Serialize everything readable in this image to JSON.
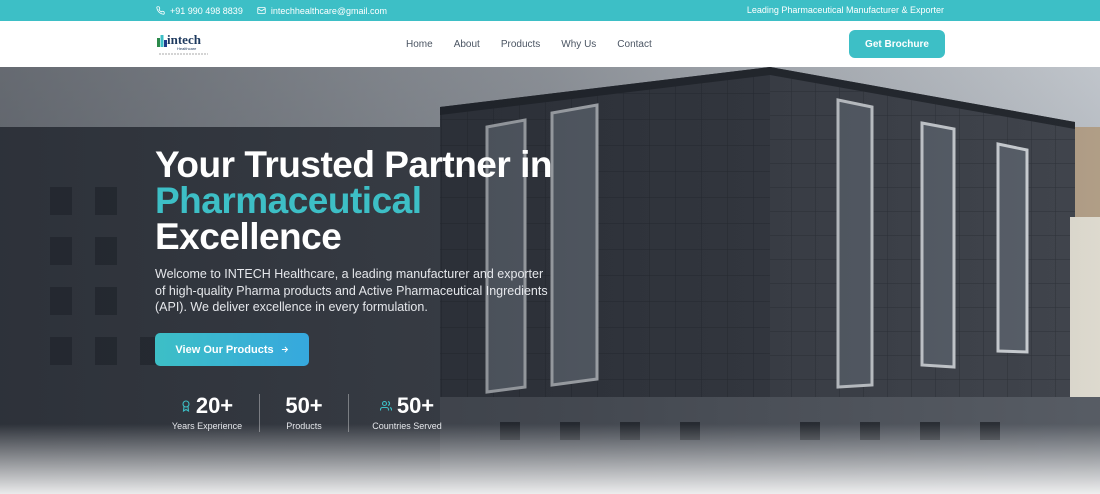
{
  "topbar": {
    "phone": "+91 990 498 8839",
    "email": "intechhealthcare@gmail.com",
    "tagline": "Leading Pharmaceutical Manufacturer & Exporter"
  },
  "header": {
    "logo_text": "intech",
    "logo_sub": "Healthcare",
    "nav": [
      "Home",
      "About",
      "Products",
      "Why Us",
      "Contact"
    ],
    "cta": "Get Brochure"
  },
  "hero": {
    "title_line1": "Your Trusted Partner in",
    "title_accent": "Pharmaceutical",
    "title_line3": "Excellence",
    "description": "Welcome to INTECH Healthcare, a leading manufacturer and exporter of high-quality Pharma products and Active Pharmaceutical Ingredients (API). We deliver excellence in every formulation.",
    "cta": "View Our Products",
    "stats": [
      {
        "value": "20+",
        "label": "Years Experience",
        "icon": "award-icon"
      },
      {
        "value": "50+",
        "label": "Products",
        "icon": ""
      },
      {
        "value": "50+",
        "label": "Countries Served",
        "icon": "users-icon"
      }
    ]
  },
  "colors": {
    "brand": "#3dbfc6",
    "cta_gradient_end": "#36a8de"
  }
}
